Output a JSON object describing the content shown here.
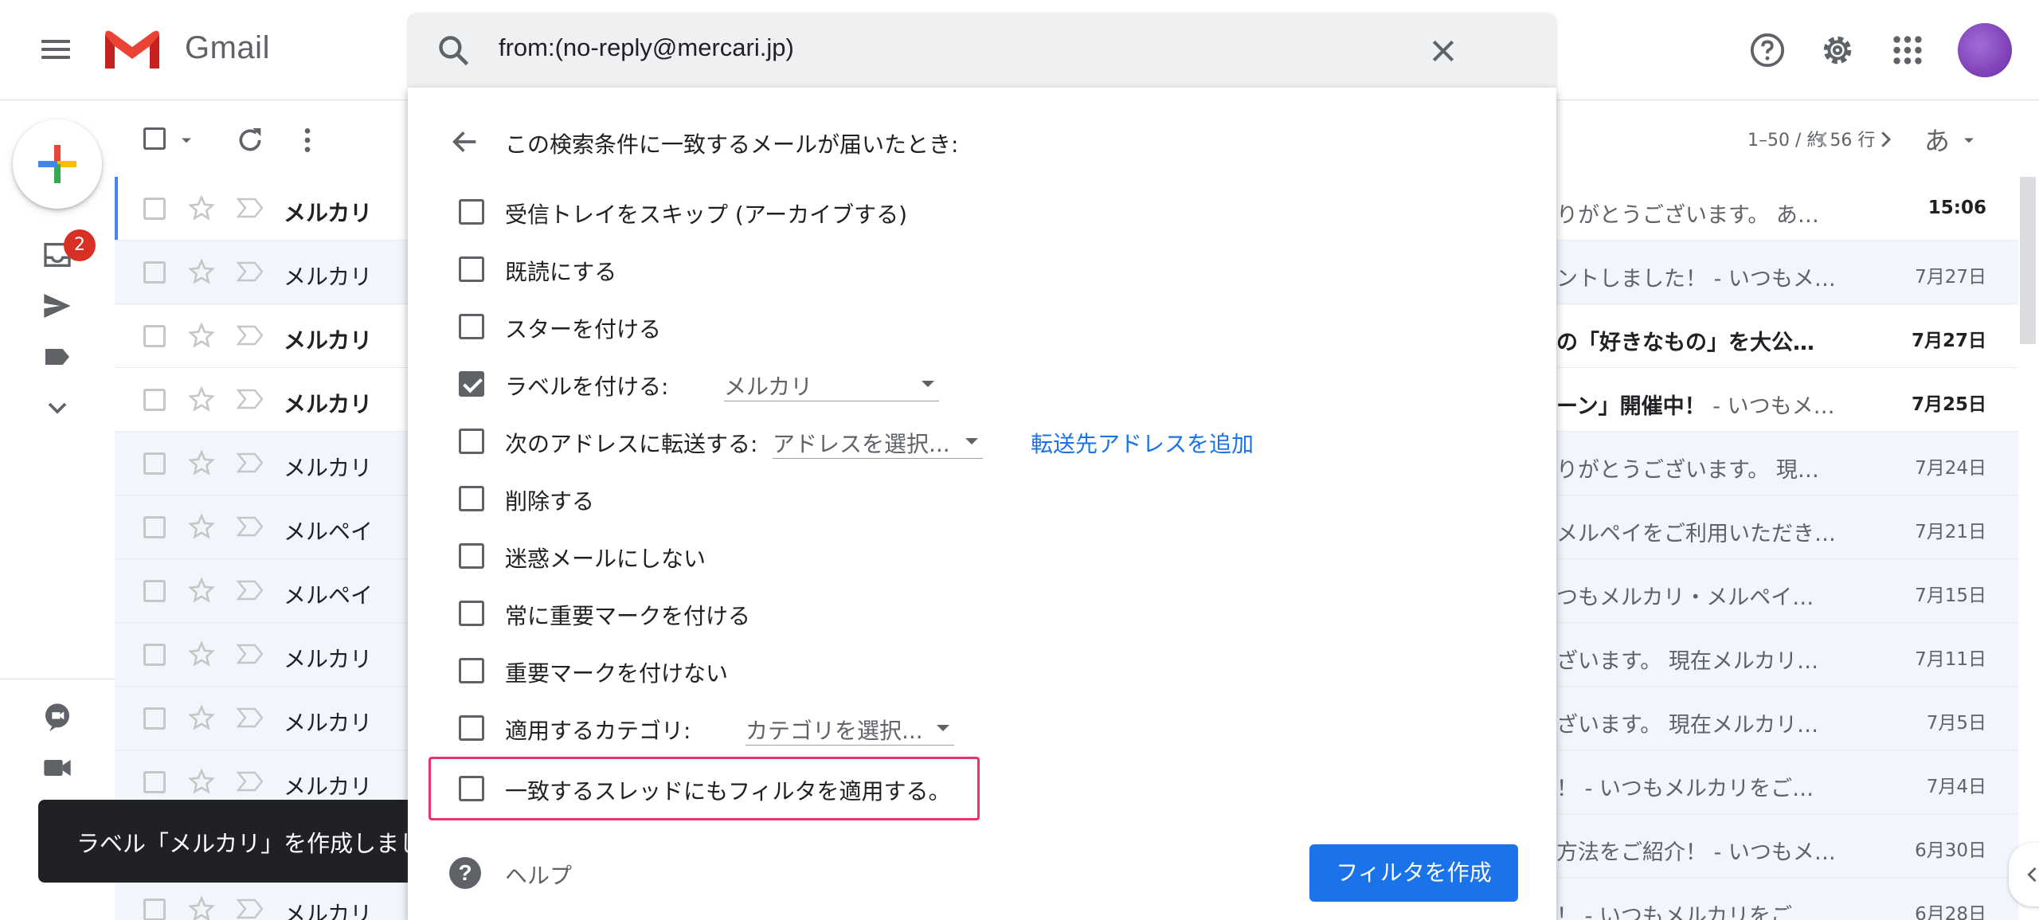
{
  "app": {
    "name": "Gmail"
  },
  "search": {
    "query": "from:(no-reply@mercari.jp)"
  },
  "rail": {
    "inbox_badge": "2"
  },
  "toolbar": {
    "pagination": "1–50 / 約 56 行",
    "input_tool": "あ"
  },
  "colors": {
    "accent": "#1a73e8",
    "highlight": "#e6336b",
    "badge": "#d93025"
  },
  "emails": [
    {
      "sender": "メルカリ",
      "snippet_strong": "",
      "snippet": "りがとうございます。 あ…",
      "date": "15:06",
      "unread": true
    },
    {
      "sender": "メルカリ",
      "snippet_strong": "",
      "snippet": "ントしました！ - いつもメ…",
      "date": "7月27日",
      "unread": false
    },
    {
      "sender": "メルカリ",
      "snippet_strong": "の「好きなもの」を大公…",
      "snippet": "",
      "date": "7月27日",
      "unread": true
    },
    {
      "sender": "メルカリ",
      "snippet_strong": "ーン」開催中！",
      "snippet": " - いつもメ…",
      "date": "7月25日",
      "unread": true
    },
    {
      "sender": "メルカリ",
      "snippet_strong": "",
      "snippet": "りがとうございます。 現…",
      "date": "7月24日",
      "unread": false
    },
    {
      "sender": "メルペイ",
      "snippet_strong": "",
      "snippet": "メルペイをご利用いただき…",
      "date": "7月21日",
      "unread": false
    },
    {
      "sender": "メルペイ",
      "snippet_strong": "",
      "snippet": "つもメルカリ・メルペイ…",
      "date": "7月15日",
      "unread": false
    },
    {
      "sender": "メルカリ",
      "snippet_strong": "",
      "snippet": "ざいます。 現在メルカリ…",
      "date": "7月11日",
      "unread": false
    },
    {
      "sender": "メルカリ",
      "snippet_strong": "",
      "snippet": "ざいます。 現在メルカリ…",
      "date": "7月5日",
      "unread": false
    },
    {
      "sender": "メルカリ",
      "snippet_strong": "",
      "snippet": "！ - いつもメルカリをご…",
      "date": "7月4日",
      "unread": false
    },
    {
      "sender": "メルカリ",
      "snippet_strong": "",
      "snippet": "方法をご紹介！ - いつもメ…",
      "date": "6月30日",
      "unread": false
    },
    {
      "sender": "メルカリ",
      "snippet_strong": "",
      "snippet": "！ - いつもメルカリをご…",
      "date": "6月28日",
      "unread": false
    }
  ],
  "snackbar": {
    "text": "ラベル「メルカリ」を作成しまし"
  },
  "filter": {
    "title": "この検索条件に一致するメールが届いたとき:",
    "options": {
      "skip_inbox": "受信トレイをスキップ (アーカイブする)",
      "mark_read": "既読にする",
      "star": "スターを付ける",
      "apply_label": "ラベルを付ける:",
      "forward": "次のアドレスに転送する:",
      "delete": "削除する",
      "never_spam": "迷惑メールにしない",
      "always_important": "常に重要マークを付ける",
      "never_important": "重要マークを付けない",
      "category": "適用するカテゴリ:",
      "also_apply": "一致するスレッドにもフィルタを適用する。"
    },
    "label_value": "メルカリ",
    "forward_value": "アドレスを選択...",
    "add_forward_link": "転送先アドレスを追加",
    "category_value": "カテゴリを選択...",
    "help": "ヘルプ",
    "create_button": "フィルタを作成"
  }
}
